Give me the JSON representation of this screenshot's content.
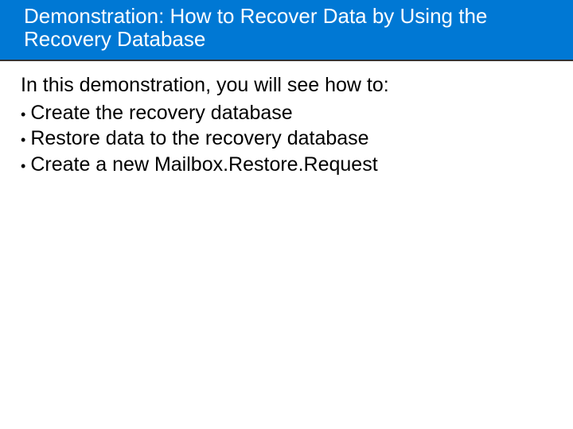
{
  "title": "Demonstration: How to Recover Data by Using the Recovery Database",
  "intro": "In this demonstration, you will see how to:",
  "bullets": [
    "Create the recovery database",
    "Restore data to the recovery database",
    "Create a new Mailbox.Restore.Request"
  ]
}
